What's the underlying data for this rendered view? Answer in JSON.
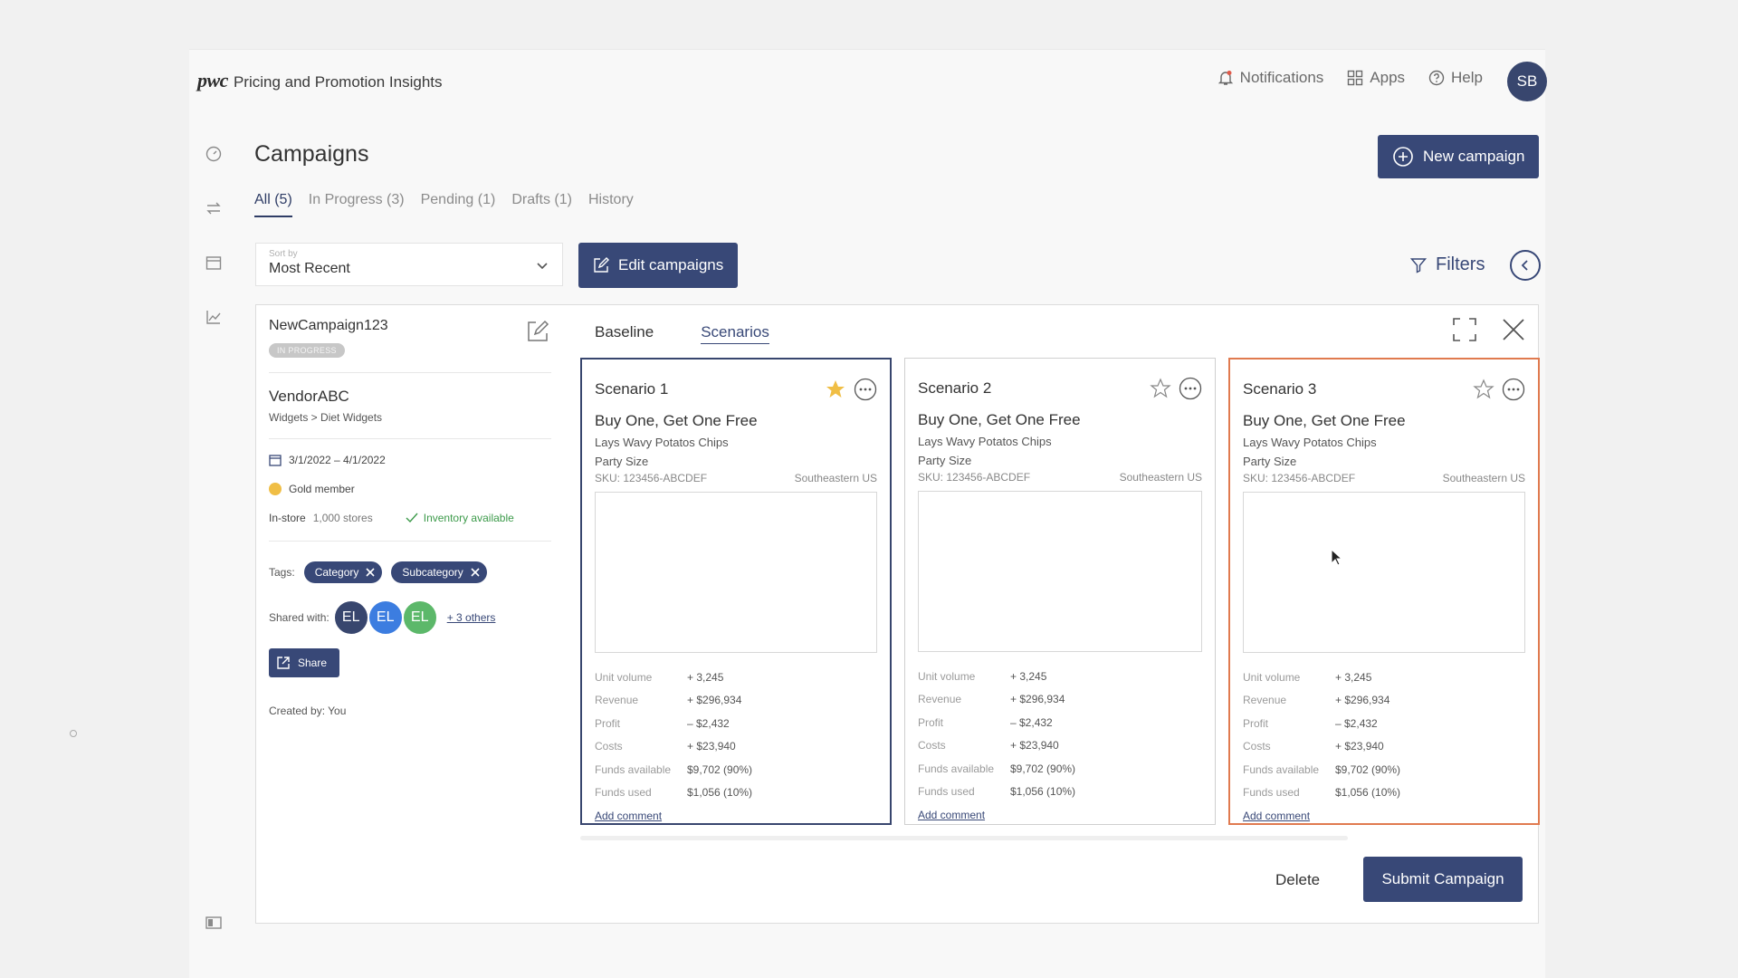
{
  "header": {
    "brand": "pwc",
    "app_name": "Pricing and Promotion Insights",
    "nav": [
      {
        "label": "Notifications",
        "icon": "bell-icon"
      },
      {
        "label": "Apps",
        "icon": "grid-icon"
      },
      {
        "label": "Help",
        "icon": "help-icon"
      }
    ],
    "user_initials": "SB"
  },
  "page": {
    "title": "Campaigns",
    "tabs": [
      {
        "label": "All (5)",
        "active": true
      },
      {
        "label": "In Progress (3)"
      },
      {
        "label": "Pending (1)"
      },
      {
        "label": "Drafts (1)"
      },
      {
        "label": "History"
      }
    ],
    "new_campaign_label": "New campaign",
    "sort_label": "Sort by",
    "sort_value": "Most Recent",
    "edit_campaigns_label": "Edit campaigns",
    "filters_label": "Filters"
  },
  "campaign": {
    "name": "NewCampaign123",
    "status": "IN PROGRESS",
    "vendor": "VendorABC",
    "category_path": "Widgets > Diet Widgets",
    "date_range": "3/1/2022 – 4/1/2022",
    "membership": "Gold member",
    "channel": "In-store",
    "stores": "1,000 stores",
    "inventory": "Inventory available",
    "tags_label": "Tags:",
    "tags": [
      "Category",
      "Subcategory"
    ],
    "shared_label": "Shared with:",
    "shared_users": [
      {
        "initials": "EL",
        "color": "#38466e"
      },
      {
        "initials": "EL",
        "color": "#3c7de0"
      },
      {
        "initials": "EL",
        "color": "#5cb86a"
      }
    ],
    "others": "+ 3 others",
    "share_label": "Share",
    "created_by": "Created by: You"
  },
  "view_tabs": [
    "Baseline",
    "Scenarios"
  ],
  "scenarios": [
    {
      "title": "Scenario 1",
      "promo": "Buy One, Get One Free",
      "product": "Lays Wavy Potatos Chips",
      "size": "Party Size",
      "sku": "SKU: 123456-ABCDEF",
      "region": "Southeastern US",
      "starred": true,
      "metrics": [
        [
          "Unit volume",
          "+ 3,245"
        ],
        [
          "Revenue",
          "+ $296,934"
        ],
        [
          "Profit",
          "– $2,432"
        ],
        [
          "Costs",
          "+ $23,940"
        ],
        [
          "Funds available",
          "$9,702 (90%)"
        ],
        [
          "Funds used",
          "$1,056 (10%)"
        ]
      ],
      "comment": "Add comment"
    },
    {
      "title": "Scenario 2",
      "promo": "Buy One, Get One Free",
      "product": "Lays Wavy Potatos Chips",
      "size": "Party Size",
      "sku": "SKU: 123456-ABCDEF",
      "region": "Southeastern US",
      "starred": false,
      "metrics": [
        [
          "Unit volume",
          "+ 3,245"
        ],
        [
          "Revenue",
          "+ $296,934"
        ],
        [
          "Profit",
          "– $2,432"
        ],
        [
          "Costs",
          "+ $23,940"
        ],
        [
          "Funds available",
          "$9,702 (90%)"
        ],
        [
          "Funds used",
          "$1,056 (10%)"
        ]
      ],
      "comment": "Add comment"
    },
    {
      "title": "Scenario 3",
      "promo": "Buy One, Get One Free",
      "product": "Lays Wavy Potatos Chips",
      "size": "Party Size",
      "sku": "SKU: 123456-ABCDEF",
      "region": "Southeastern US",
      "starred": false,
      "metrics": [
        [
          "Unit volume",
          "+ 3,245"
        ],
        [
          "Revenue",
          "+ $296,934"
        ],
        [
          "Profit",
          "– $2,432"
        ],
        [
          "Costs",
          "+ $23,940"
        ],
        [
          "Funds available",
          "$9,702 (90%)"
        ],
        [
          "Funds used",
          "$1,056 (10%)"
        ]
      ],
      "comment": "Add comment"
    }
  ],
  "actions": {
    "delete": "Delete",
    "submit": "Submit Campaign"
  },
  "colors": {
    "primary": "#384877",
    "accent_hover": "#e07a4f",
    "star": "#f0be45"
  }
}
